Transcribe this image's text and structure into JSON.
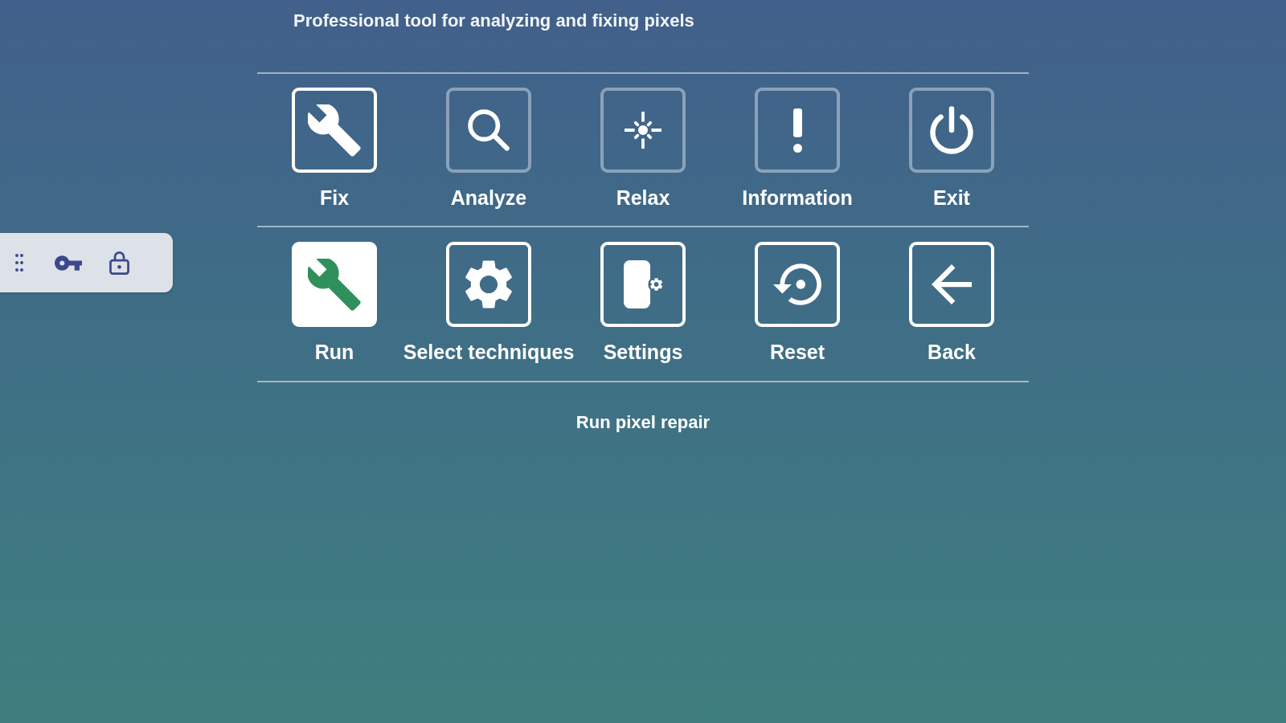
{
  "subtitle": "Professional tool for analyzing and fixing pixels",
  "mode_tabs": [
    {
      "label": "Fix",
      "selected": true
    },
    {
      "label": "Analyze",
      "selected": false
    },
    {
      "label": "Relax",
      "selected": false
    },
    {
      "label": "Information",
      "selected": false
    },
    {
      "label": "Exit",
      "selected": false
    }
  ],
  "actions": [
    {
      "label": "Run",
      "selected": true
    },
    {
      "label": "Select techniques",
      "selected": false
    },
    {
      "label": "Settings",
      "selected": false
    },
    {
      "label": "Reset",
      "selected": false
    },
    {
      "label": "Back",
      "selected": false
    }
  ],
  "status_text": "Run pixel repair"
}
